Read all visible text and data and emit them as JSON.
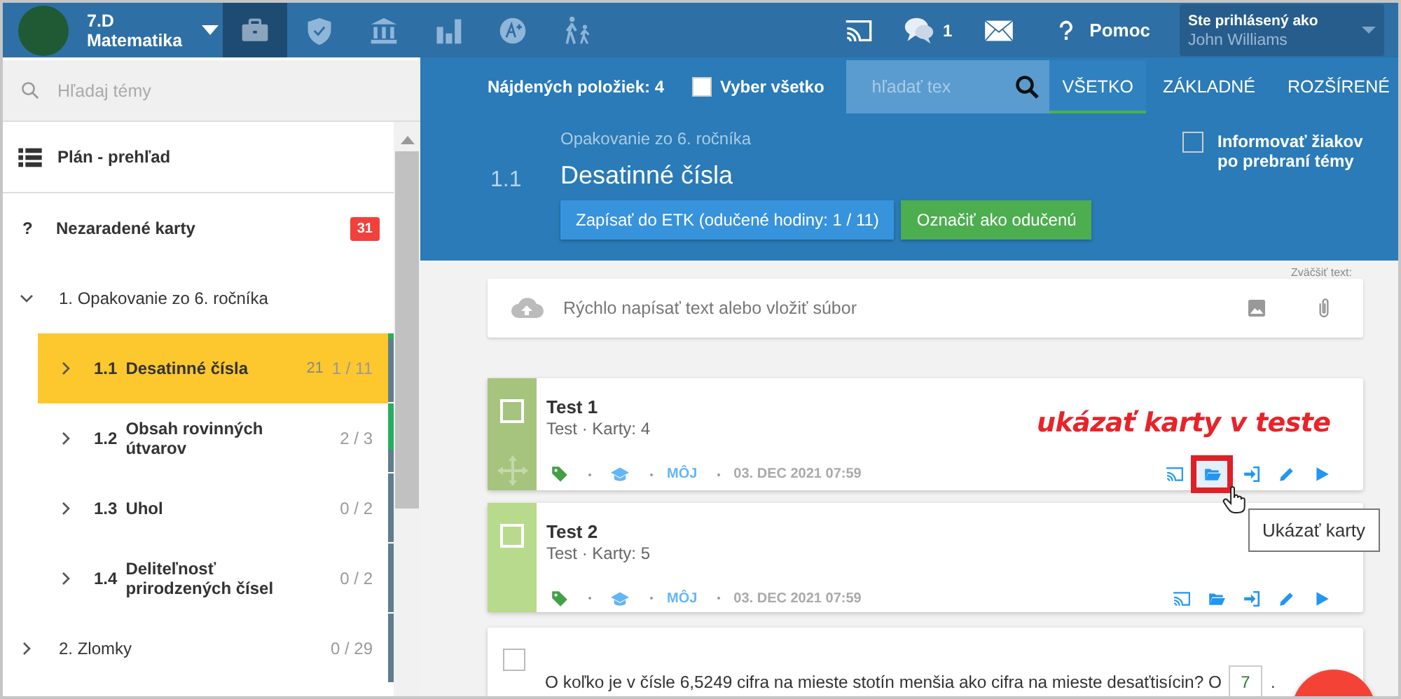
{
  "header": {
    "class_name": "7.D",
    "subject": "Matematika",
    "nav": [
      {
        "kind": "briefcase",
        "selected": true
      },
      {
        "kind": "shield",
        "selected": false
      },
      {
        "kind": "bank",
        "selected": false
      },
      {
        "kind": "chart",
        "selected": false
      },
      {
        "kind": "grade",
        "selected": false
      },
      {
        "kind": "walkers",
        "selected": false
      }
    ],
    "messages_count": "1",
    "help": "Pomoc",
    "user_label": "Ste prihlásený ako",
    "user_name": "John Williams"
  },
  "sidebar": {
    "search": {
      "placeholder": "Hľadaj témy"
    },
    "items": [
      {
        "kind": "overview",
        "title": "Plán - prehľad"
      },
      {
        "kind": "unassigned",
        "icon": "?",
        "title": "Nezaradené karty",
        "badge": "31"
      },
      {
        "kind": "chapter",
        "title": "1. Opakovanie zo 6. ročníka",
        "expanded": true,
        "children": [
          {
            "number": "1.1",
            "title": "Desatinné čísla",
            "count": "21",
            "progress": "1 / 11",
            "level": 0.09,
            "selected": true
          },
          {
            "number": "1.2",
            "title": "Obsah rovinných útvarov",
            "progress": "2 / 3",
            "level": 0.67,
            "selected": false
          },
          {
            "number": "1.3",
            "title": "Uhol",
            "progress": "0 / 2",
            "level": 0,
            "selected": false
          },
          {
            "number": "1.4",
            "title": "Deliteľnosť prirodzených čísel",
            "progress": "0 / 2",
            "level": 0,
            "selected": false
          }
        ]
      },
      {
        "kind": "chapter",
        "title": "2. Zlomky",
        "expanded": false,
        "progress": "0 / 29",
        "level": 0
      }
    ]
  },
  "toolbar": {
    "found": "Nájdených položiek: 4",
    "select_all": {
      "label": "Vyber všetko",
      "checked": false
    },
    "search": {
      "placeholder": "hľadať tex"
    },
    "filters": [
      {
        "label": "VŠETKO",
        "selected": true
      },
      {
        "label": "ZÁKLADNÉ",
        "selected": false
      },
      {
        "label": "ROZŠÍRENÉ",
        "selected": false
      }
    ]
  },
  "topic": {
    "parent": "Opakovanie zo 6. ročníka",
    "number": "1.1",
    "title": "Desatinné čísla",
    "buttons": [
      {
        "label": "Zapísať do ETK (odučené hodiny: 1 / 11)",
        "kind": "primary"
      },
      {
        "label": "Označiť ako odučenú",
        "kind": "success"
      }
    ],
    "notify": {
      "label": "Informovať žiakov po prebraní témy",
      "checked": false
    }
  },
  "composer": {
    "zoom_label": "Zväčšiť text:",
    "placeholder": "Rýchlo napísať text alebo vložiť súbor"
  },
  "cards": [
    {
      "kind": "test",
      "title": "Test 1",
      "subtitle": "Test · Karty: 4",
      "owner": "MÔJ",
      "date": "03. DEC 2021 07:59",
      "checked": false,
      "hovered": true,
      "color": "#a6c47e",
      "actions": [
        {
          "kind": "cast",
          "highlighted": false
        },
        {
          "kind": "folder",
          "highlighted": true
        },
        {
          "kind": "enter",
          "highlighted": false
        },
        {
          "kind": "pencil",
          "highlighted": false
        },
        {
          "kind": "play",
          "highlighted": false
        }
      ]
    },
    {
      "kind": "test",
      "title": "Test 2",
      "subtitle": "Test · Karty: 5",
      "owner": "MÔJ",
      "date": "03. DEC 2021 07:59",
      "checked": false,
      "hovered": false,
      "color": "#b8da8c",
      "actions": [
        {
          "kind": "cast",
          "highlighted": false
        },
        {
          "kind": "folder",
          "highlighted": false
        },
        {
          "kind": "enter",
          "highlighted": false
        },
        {
          "kind": "pencil",
          "highlighted": false
        },
        {
          "kind": "play",
          "highlighted": false
        }
      ]
    },
    {
      "kind": "question",
      "checked": false,
      "text": "O koľko je v čísle 6,5249 cifra na mieste stotín menšia ako cifra na mieste desaťtisícin? O",
      "answer": "7",
      "after": "."
    }
  ],
  "annotation": "ukázať karty v teste",
  "tooltip": "Ukázať karty"
}
